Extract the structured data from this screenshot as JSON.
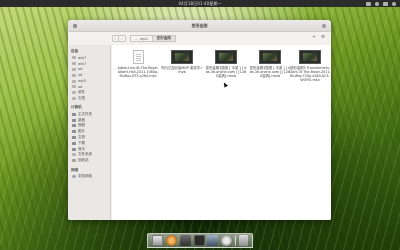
{
  "top_panel": {
    "clock": "04月18日01:40星期一"
  },
  "window": {
    "title": "变形金刚",
    "toolbar": {
      "back_glyph": "‹",
      "forward_glyph": "›",
      "breadcrumbs": [
        "... mp3",
        "变形金刚"
      ],
      "add_glyph": "+",
      "settings_glyph": "⚙"
    },
    "sidebar": {
      "sections": [
        {
          "heading": "设备",
          "items": [
            "win7",
            "win7",
            "xd",
            "xd",
            "mp3",
            "xd",
            "软件",
            "文档"
          ]
        },
        {
          "heading": "计算机",
          "items": [
            "主文件夹",
            "桌面",
            "视频",
            "图片",
            "文档",
            "下载",
            "音乐",
            "文件系统",
            "回收站"
          ]
        },
        {
          "heading": "网络",
          "items": [
            "浏览网络"
          ]
        }
      ]
    },
    "files": [
      {
        "name": "Adele.Live.At.The.Royal.Albert.Hall.2011.1080p.BluRay.DTS.x264.mkv",
        "kind": "video"
      },
      {
        "name": "阿凡达加长版HDP 英双字.rmvb",
        "kind": "video"
      },
      {
        "name": "变形金刚3国语 [ 中英 ] [ bbs.3e-online.com ] [1280高清].rmvb",
        "kind": "video"
      },
      {
        "name": "变形金刚3国语 [ 中英 ] [ bbs.3e-online.com ] [1280高清].rmvb",
        "kind": "document"
      },
      {
        "name": "变形金刚3 Transformers.Dark.Of.The.Moon.2011.BluRay.720p.x264.AC3-WOFEI.mkv",
        "kind": "video"
      }
    ]
  },
  "dock": {
    "items": [
      "files",
      "music",
      "media",
      "terminal",
      "screen",
      "settings",
      "trash"
    ]
  }
}
